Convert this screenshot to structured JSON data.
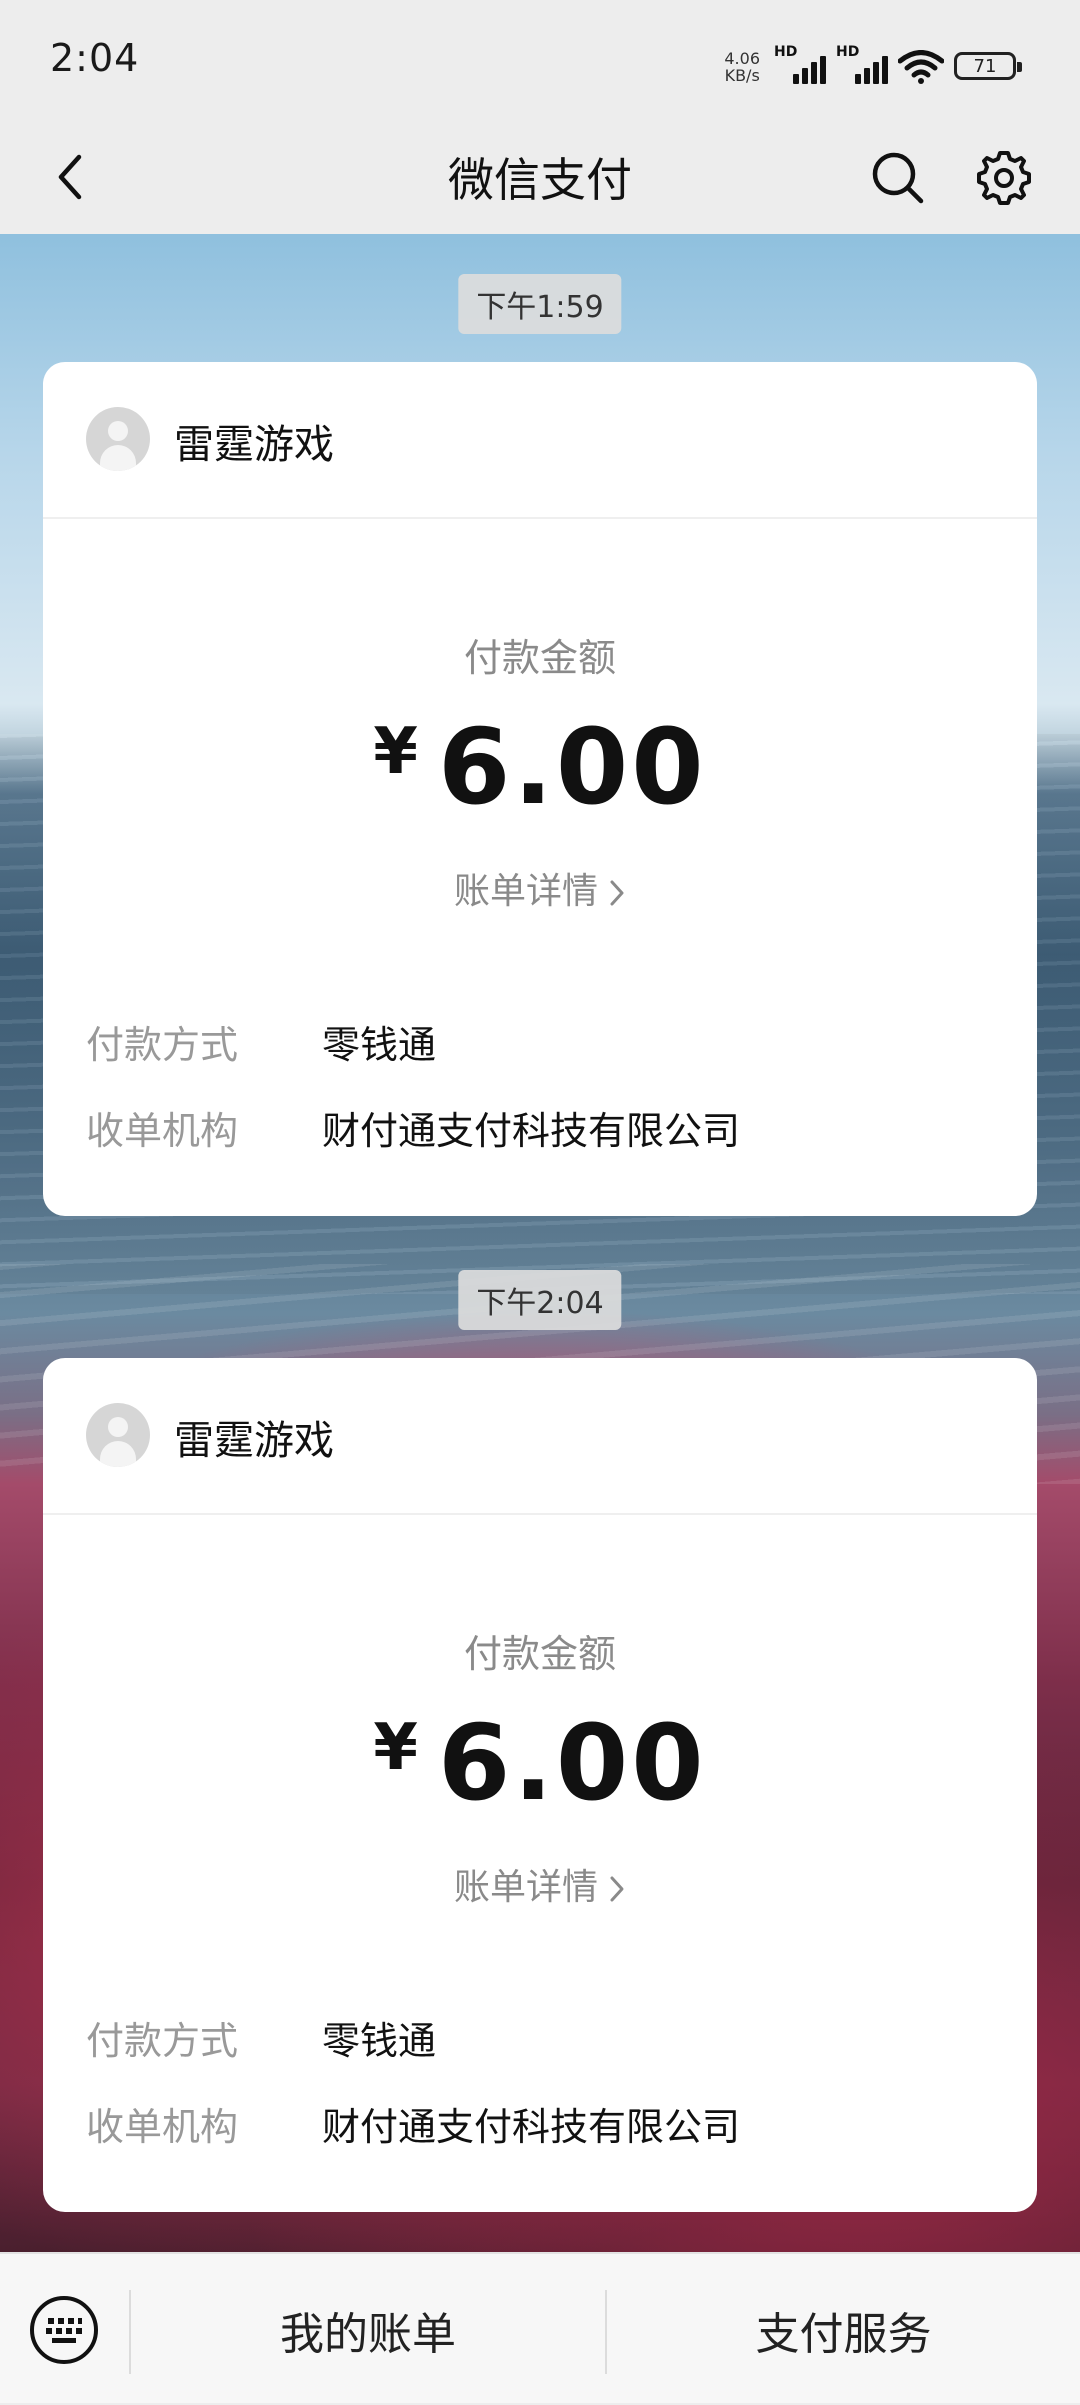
{
  "status_bar": {
    "time": "2:04",
    "net_speed_value": "4.06",
    "net_speed_unit": "KB/s",
    "sim1_label": "HD",
    "sim2_label": "HD",
    "battery": "71"
  },
  "nav": {
    "title": "微信支付",
    "back_icon": "chevron-left-icon",
    "search_icon": "search-icon",
    "settings_icon": "gear-icon"
  },
  "messages": [
    {
      "time": "下午1:59",
      "merchant": "雷霆游戏",
      "amount_label": "付款金额",
      "currency": "¥",
      "amount": "6.00",
      "detail_link": "账单详情",
      "rows": [
        {
          "key": "付款方式",
          "value": "零钱通"
        },
        {
          "key": "收单机构",
          "value": "财付通支付科技有限公司"
        }
      ]
    },
    {
      "time": "下午2:04",
      "merchant": "雷霆游戏",
      "amount_label": "付款金额",
      "currency": "¥",
      "amount": "6.00",
      "detail_link": "账单详情",
      "rows": [
        {
          "key": "付款方式",
          "value": "零钱通"
        },
        {
          "key": "收单机构",
          "value": "财付通支付科技有限公司"
        }
      ]
    }
  ],
  "bottom_bar": {
    "keyboard_icon": "keyboard-icon",
    "tab1": "我的账单",
    "tab2": "支付服务"
  },
  "colors": {
    "page_bg": "#ededed",
    "card_bg": "#ffffff",
    "muted_text": "#8a8a8a"
  }
}
